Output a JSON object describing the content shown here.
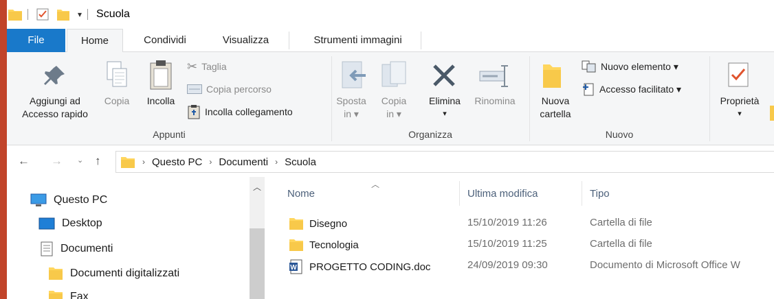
{
  "window": {
    "title": "Scuola"
  },
  "tabs": [
    "File",
    "Home",
    "Condividi",
    "Visualizza",
    "Strumenti immagini"
  ],
  "ribbon": {
    "appunti": {
      "label": "Appunti",
      "pin_line1": "Aggiungi ad",
      "pin_line2": "Accesso rapido",
      "copy": "Copia",
      "paste": "Incolla",
      "cut": "Taglia",
      "copy_path": "Copia percorso",
      "paste_link": "Incolla collegamento"
    },
    "organizza": {
      "label": "Organizza",
      "move_line1": "Sposta",
      "move_line2": "in ▾",
      "copyto_line1": "Copia",
      "copyto_line2": "in ▾",
      "delete": "Elimina",
      "delete_arrow": "▾",
      "rename": "Rinomina"
    },
    "nuovo": {
      "label": "Nuovo",
      "new_folder_line1": "Nuova",
      "new_folder_line2": "cartella",
      "new_item": "Nuovo elemento ▾",
      "easy_access": "Accesso facilitato ▾"
    },
    "apri": {
      "properties": "Proprietà",
      "properties_arrow": "▾"
    }
  },
  "address": {
    "crumbs": [
      "Questo PC",
      "Documenti",
      "Scuola"
    ]
  },
  "navpane": {
    "items": [
      "Questo PC",
      "Desktop",
      "Documenti",
      "Documenti digitalizzati",
      "Fax"
    ]
  },
  "filelist": {
    "columns": [
      "Nome",
      "Ultima modifica",
      "Tipo"
    ],
    "rows": [
      {
        "name": "Disegno",
        "modified": "15/10/2019 11:26",
        "type": "Cartella di file",
        "icon": "folder-icon"
      },
      {
        "name": "Tecnologia",
        "modified": "15/10/2019 11:25",
        "type": "Cartella di file",
        "icon": "folder-icon"
      },
      {
        "name": "PROGETTO CODING.doc",
        "modified": "24/09/2019 09:30",
        "type": "Documento di Microsoft Office W",
        "icon": "word-doc-icon"
      }
    ]
  },
  "colors": {
    "file_tab": "#1979ca",
    "folder": "#ffd65e",
    "header_text": "#4c607a",
    "background_accent": "#c1442a"
  }
}
